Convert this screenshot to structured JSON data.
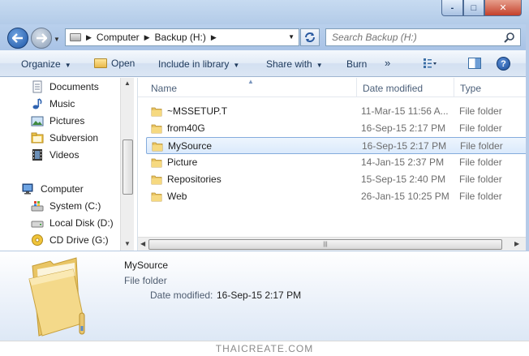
{
  "window": {
    "controls": {
      "minimize": "-",
      "maximize": "□",
      "close": "✕"
    }
  },
  "navigation": {
    "breadcrumbs": [
      "Computer",
      "Backup (H:)"
    ],
    "search_placeholder": "Search Backup (H:)"
  },
  "commandbar": {
    "organize": "Organize",
    "open": "Open",
    "include_in_library": "Include in library",
    "share_with": "Share with",
    "burn": "Burn",
    "more": "»"
  },
  "navpane": {
    "items": [
      {
        "label": "Documents",
        "icon": "documents-icon"
      },
      {
        "label": "Music",
        "icon": "music-icon"
      },
      {
        "label": "Pictures",
        "icon": "pictures-icon"
      },
      {
        "label": "Subversion",
        "icon": "subversion-icon"
      },
      {
        "label": "Videos",
        "icon": "videos-icon"
      },
      {
        "label": "Computer",
        "icon": "computer-icon"
      },
      {
        "label": "System  (C:)",
        "icon": "windows-drive-icon"
      },
      {
        "label": "Local Disk (D:)",
        "icon": "drive-icon"
      },
      {
        "label": "CD Drive (G:)",
        "icon": "cd-drive-icon"
      }
    ]
  },
  "filelist": {
    "columns": {
      "name": "Name",
      "date": "Date modified",
      "type": "Type"
    },
    "rows": [
      {
        "name": "~MSSETUP.T",
        "date": "11-Mar-15 11:56 A...",
        "type": "File folder",
        "selected": false
      },
      {
        "name": "from40G",
        "date": "16-Sep-15 2:17 PM",
        "type": "File folder",
        "selected": false
      },
      {
        "name": "MySource",
        "date": "16-Sep-15 2:17 PM",
        "type": "File folder",
        "selected": true
      },
      {
        "name": "Picture",
        "date": "14-Jan-15 2:37 PM",
        "type": "File folder",
        "selected": false
      },
      {
        "name": "Repositories",
        "date": "15-Sep-15 2:40 PM",
        "type": "File folder",
        "selected": false
      },
      {
        "name": "Web",
        "date": "26-Jan-15 10:25 PM",
        "type": "File folder",
        "selected": false
      }
    ]
  },
  "details": {
    "name": "MySource",
    "type": "File folder",
    "date_label": "Date modified:",
    "date_value": "16-Sep-15 2:17 PM"
  },
  "watermark": "THAICREATE.COM",
  "colors": {
    "selection_border": "#84acdd",
    "selection_fill": "#dbeafc",
    "folder_yellow": "#f2c94c",
    "header_text": "#4c607a"
  }
}
